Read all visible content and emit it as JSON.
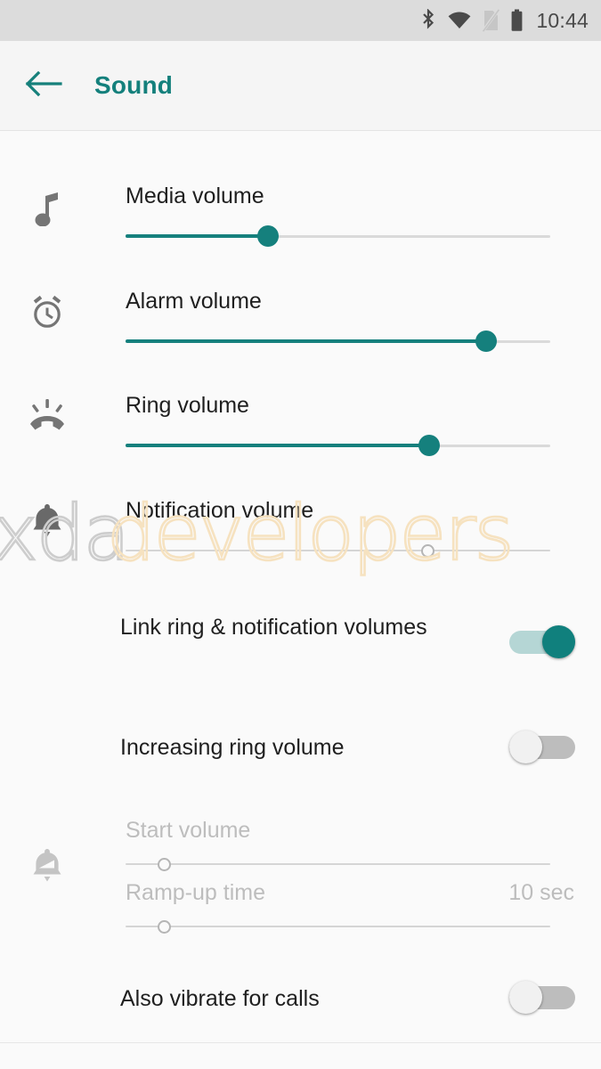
{
  "status_bar": {
    "time": "10:44",
    "icons": [
      {
        "name": "bluetooth-icon",
        "label": "Bluetooth"
      },
      {
        "name": "wifi-icon",
        "label": "Wi-Fi"
      },
      {
        "name": "no-sim-icon",
        "label": "No SIM card"
      },
      {
        "name": "battery-icon",
        "label": "Battery full"
      }
    ],
    "background": "#dcdcdc"
  },
  "app_bar": {
    "back_label": "Back",
    "title": "Sound",
    "accent_color": "#14807c"
  },
  "volume_sliders": [
    {
      "icon": "music-note-icon",
      "label": "Media volume",
      "percent": 33.5,
      "enabled": true
    },
    {
      "icon": "alarm-clock-icon",
      "label": "Alarm volume",
      "percent": 85,
      "enabled": true
    },
    {
      "icon": "ring-volume-icon",
      "label": "Ring volume",
      "percent": 71.5,
      "enabled": true
    },
    {
      "icon": "notification-bell-icon",
      "label": "Notification volume",
      "percent": 71,
      "enabled": false
    }
  ],
  "toggles": [
    {
      "label": "Link ring & notification volumes",
      "state": "on",
      "state_label": "On"
    },
    {
      "label": "Increasing ring volume",
      "state": "off",
      "state_label": "Off"
    },
    {
      "label": "Also vibrate for calls",
      "state": "off",
      "state_label": "Off"
    }
  ],
  "increasing_ring": {
    "icon": "increasing-bell-icon",
    "enabled": false,
    "start_volume": {
      "label": "Start volume",
      "percent": 9,
      "value": ""
    },
    "ramp_up": {
      "label": "Ramp-up time",
      "percent": 9,
      "value": "10 sec"
    }
  },
  "watermark": {
    "text_primary": "xda",
    "text_secondary": "developers",
    "color_primary": "#cccccc",
    "color_secondary": "#f5e0bc"
  },
  "theme": {
    "accent": "#15807d",
    "track_inactive": "#dadada",
    "background": "#fafafa",
    "text_primary": "#1f1f1f",
    "text_disabled": "#bdbdbd",
    "icon_gray": "#757575"
  }
}
